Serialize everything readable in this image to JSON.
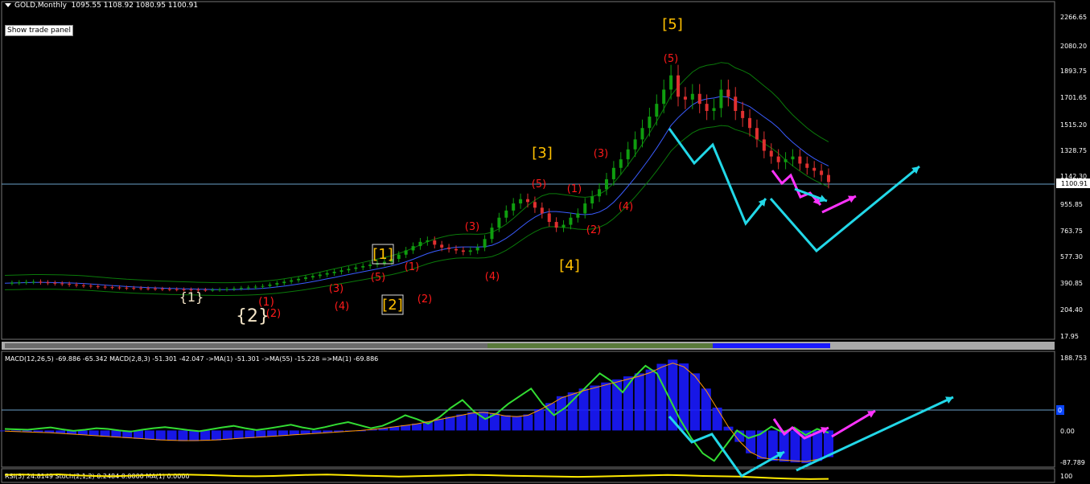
{
  "header": {
    "symbol": "GOLD,Monthly",
    "ohlc": "1095.55 1108.92 1080.95 1100.91"
  },
  "trade_panel_button": "Show trade panel",
  "price_axis_labels": [
    "2266.65",
    "2080.20",
    "1893.75",
    "1701.65",
    "1515.20",
    "1328.75",
    "1142.30",
    "955.85",
    "763.75",
    "577.30",
    "390.85",
    "204.40",
    "17.95"
  ],
  "current_price_label": "1100.91",
  "macd_header": "MACD(12,26,5) -69.886 -65.342   MACD(2,8,3) -51.301 -42.047   ->MA(1) -51.301   ->MA(55) -15.228   =>MA(1) -69.886",
  "macd_axis_labels": [
    "188.753",
    "0.00",
    "-87.789"
  ],
  "macd_zero_marker": "0",
  "rsi_header": "RSI(5) 24.8149   Stoch(2,1,2) 0.2484 0.0000   MA(1) 0.0000",
  "rsi_axis_label": "100",
  "colors": {
    "up": "#0f9d0f",
    "down": "#e03030",
    "wave_red": "#ff1a1a",
    "wave_gold": "#ffc000",
    "cyan": "#22d8e8",
    "magenta": "#ff33ff",
    "macd_line": "#33dd33",
    "macd_hist": "#1a1aff",
    "rsi_line": "#ffea00"
  },
  "wave_labels": [
    {
      "text": "{1}",
      "color": "white"
    },
    {
      "text": "{2}",
      "color": "white"
    },
    {
      "text": "(1)",
      "color": "red"
    },
    {
      "text": "(2)",
      "color": "red"
    },
    {
      "text": "(3)",
      "color": "red"
    },
    {
      "text": "(4)",
      "color": "red"
    },
    {
      "text": "(5)",
      "color": "red"
    },
    {
      "text": "[1]",
      "color": "gold"
    },
    {
      "text": "(1)",
      "color": "red"
    },
    {
      "text": "[2]",
      "color": "gold"
    },
    {
      "text": "(2)",
      "color": "red"
    },
    {
      "text": "(3)",
      "color": "red"
    },
    {
      "text": "(4)",
      "color": "red"
    },
    {
      "text": "(5)",
      "color": "red"
    },
    {
      "text": "[3]",
      "color": "gold"
    },
    {
      "text": "(1)",
      "color": "red"
    },
    {
      "text": "(2)",
      "color": "red"
    },
    {
      "text": "[4]",
      "color": "gold"
    },
    {
      "text": "(3)",
      "color": "red"
    },
    {
      "text": "(4)",
      "color": "red"
    },
    {
      "text": "(5)",
      "color": "red"
    },
    {
      "text": "[5]",
      "color": "gold"
    }
  ],
  "chart_data": [
    {
      "type": "candlestick",
      "title": "GOLD,Monthly",
      "ylim": [
        17.95,
        2266.65
      ],
      "series": [
        {
          "name": "GOLD,Monthly",
          "values": [
            390,
            392,
            395,
            398,
            400,
            395,
            392,
            388,
            385,
            380,
            375,
            372,
            368,
            365,
            362,
            360,
            358,
            356,
            355,
            353,
            352,
            350,
            348,
            347,
            346,
            345,
            344,
            343,
            342,
            343,
            345,
            348,
            352,
            356,
            360,
            365,
            370,
            380,
            390,
            400,
            410,
            420,
            430,
            440,
            450,
            460,
            470,
            480,
            490,
            500,
            510,
            520,
            530,
            540,
            560,
            590,
            620,
            650,
            680,
            690,
            660,
            640,
            630,
            620,
            610,
            620,
            640,
            700,
            780,
            850,
            900,
            950,
            980,
            960,
            920,
            880,
            820,
            780,
            800,
            850,
            880,
            950,
            1000,
            1050,
            1120,
            1200,
            1260,
            1330,
            1400,
            1480,
            1560,
            1650,
            1750,
            1850,
            1700,
            1680,
            1720,
            1650,
            1600,
            1620,
            1750,
            1700,
            1600,
            1550,
            1480,
            1400,
            1320,
            1280,
            1240,
            1260,
            1280,
            1230,
            1200,
            1180,
            1150,
            1100
          ]
        }
      ]
    },
    {
      "type": "bar",
      "title": "MACD(12,26,5)",
      "ylim": [
        -87.789,
        188.753
      ],
      "series": [
        {
          "name": "MACD(12,26,5)",
          "values": [
            -2,
            -3,
            -4,
            -5,
            -6,
            -8,
            -10,
            -12,
            -14,
            -16,
            -18,
            -20,
            -22,
            -24,
            -26,
            -27,
            -28,
            -28,
            -27,
            -26,
            -24,
            -22,
            -20,
            -18,
            -16,
            -14,
            -12,
            -10,
            -8,
            -6,
            -4,
            -2,
            0,
            3,
            6,
            10,
            14,
            18,
            24,
            30,
            36,
            42,
            48,
            50,
            46,
            40,
            38,
            42,
            56,
            72,
            90,
            100,
            110,
            118,
            126,
            134,
            142,
            150,
            160,
            175,
            186,
            176,
            150,
            110,
            60,
            10,
            -30,
            -60,
            -75,
            -80,
            -82,
            -84,
            -86,
            -80,
            -70
          ]
        },
        {
          "name": "MACD(2,8,3)",
          "values": [
            4,
            3,
            2,
            5,
            8,
            3,
            -1,
            2,
            6,
            4,
            0,
            -3,
            2,
            6,
            9,
            5,
            1,
            -2,
            3,
            8,
            12,
            6,
            1,
            5,
            10,
            15,
            8,
            3,
            9,
            16,
            22,
            14,
            6,
            12,
            25,
            40,
            30,
            18,
            35,
            60,
            80,
            50,
            30,
            45,
            70,
            90,
            110,
            70,
            40,
            60,
            90,
            120,
            150,
            130,
            100,
            140,
            170,
            150,
            90,
            30,
            -20,
            -60,
            -80,
            -40,
            0,
            -20,
            -10,
            10,
            -5,
            8,
            -12,
            4,
            -6
          ]
        }
      ]
    },
    {
      "type": "line",
      "title": "RSI(5)",
      "ylim": [
        0,
        100
      ],
      "series": [
        {
          "name": "RSI(5)",
          "values": [
            60,
            62,
            58,
            64,
            55,
            50,
            48,
            52,
            57,
            61,
            63,
            59,
            54,
            49,
            47,
            50,
            55,
            60,
            62,
            58,
            53,
            49,
            45,
            48,
            52,
            56,
            60,
            57,
            53,
            50,
            47,
            44,
            42,
            45,
            48,
            52,
            56,
            59,
            55,
            50,
            47,
            44,
            38,
            30,
            25,
            22,
            24
          ]
        }
      ]
    }
  ]
}
